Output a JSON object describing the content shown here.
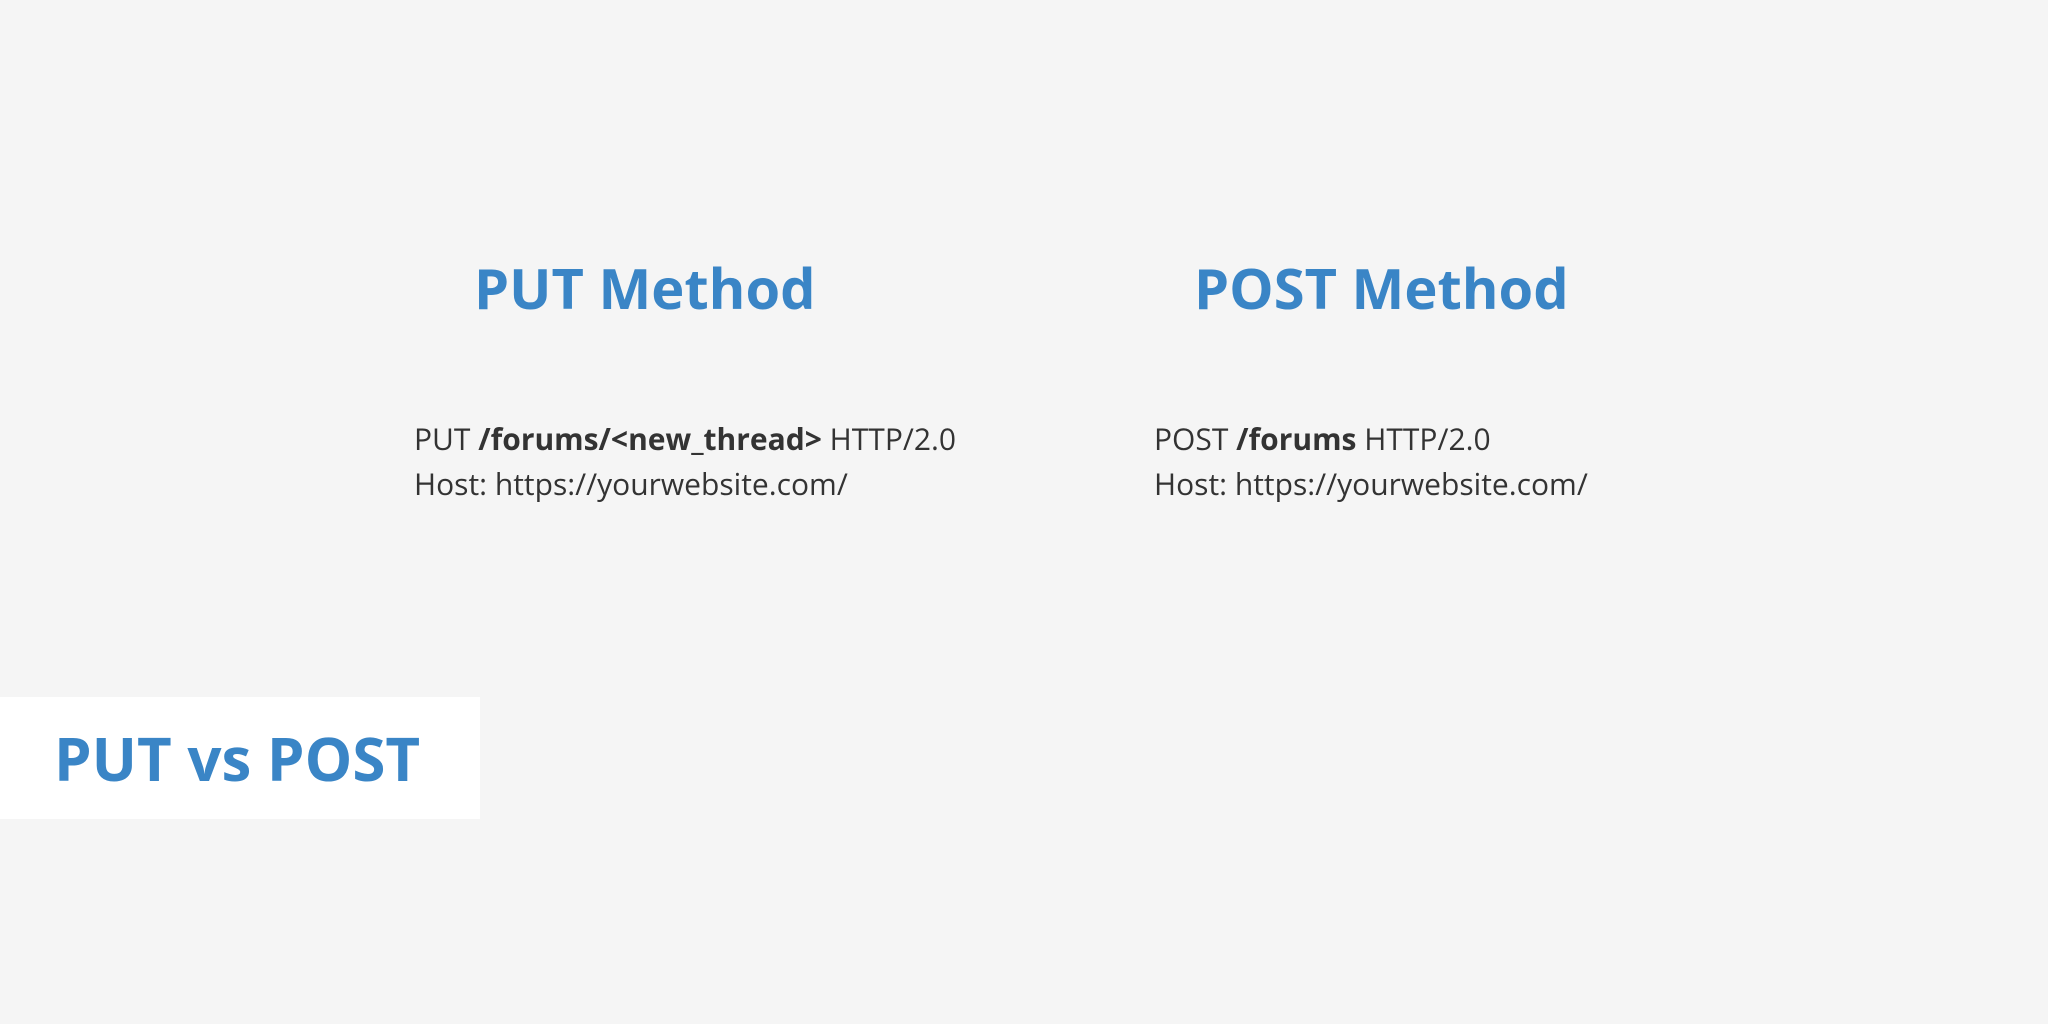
{
  "left": {
    "heading": "PUT Method",
    "line1_prefix": "PUT ",
    "line1_bold": "/forums/<new_thread>",
    "line1_suffix": " HTTP/2.0",
    "line2": "Host: https://yourwebsite.com/"
  },
  "right": {
    "heading": "POST Method",
    "line1_prefix": "POST ",
    "line1_bold": "/forums",
    "line1_suffix": " HTTP/2.0",
    "line2": "Host: https://yourwebsite.com/"
  },
  "badge": "PUT vs POST"
}
